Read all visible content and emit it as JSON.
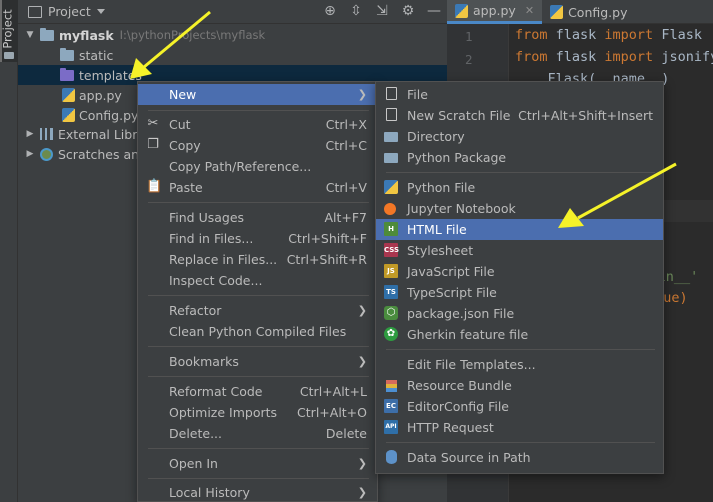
{
  "side_strip": {
    "tab_label": "Project"
  },
  "project_panel": {
    "title": "Project",
    "tree": {
      "root": {
        "name": "myflask",
        "path": "I:\\pythonProjects\\myflask"
      },
      "items": [
        {
          "name": "static"
        },
        {
          "name": "templates"
        },
        {
          "name": "app.py"
        },
        {
          "name": "Config.py"
        },
        {
          "name": "External Libra"
        },
        {
          "name": "Scratches and"
        }
      ]
    }
  },
  "editor": {
    "tabs": [
      {
        "label": "app.py"
      },
      {
        "label": "Config.py"
      }
    ],
    "line_numbers": [
      "1",
      "2"
    ],
    "code": {
      "line1": {
        "kw1": "from",
        "mod": " flask ",
        "kw2": "import",
        "name": " Flask"
      },
      "line2": {
        "kw1": "from",
        "mod": " flask ",
        "kw2": "import",
        "name": " jsonify"
      },
      "line3": "    Flask(__name__)",
      "line4_str": "'__main__'",
      "line5": "True)"
    }
  },
  "context_menu": {
    "items": [
      {
        "label": "New",
        "submenu": true,
        "highlighted": true
      },
      {
        "label": "Cut",
        "shortcut": "Ctrl+X",
        "icon": "scissors-icon"
      },
      {
        "label": "Copy",
        "shortcut": "Ctrl+C",
        "icon": "copy-icon"
      },
      {
        "label": "Copy Path/Reference..."
      },
      {
        "label": "Paste",
        "shortcut": "Ctrl+V",
        "icon": "paste-icon"
      },
      {
        "label": "Find Usages",
        "shortcut": "Alt+F7"
      },
      {
        "label": "Find in Files...",
        "shortcut": "Ctrl+Shift+F"
      },
      {
        "label": "Replace in Files...",
        "shortcut": "Ctrl+Shift+R"
      },
      {
        "label": "Inspect Code..."
      },
      {
        "label": "Refactor",
        "submenu": true
      },
      {
        "label": "Clean Python Compiled Files"
      },
      {
        "label": "Bookmarks",
        "submenu": true
      },
      {
        "label": "Reformat Code",
        "shortcut": "Ctrl+Alt+L"
      },
      {
        "label": "Optimize Imports",
        "shortcut": "Ctrl+Alt+O"
      },
      {
        "label": "Delete...",
        "shortcut": "Delete"
      },
      {
        "label": "Open In",
        "submenu": true
      },
      {
        "label": "Local History",
        "submenu": true
      }
    ]
  },
  "new_submenu": {
    "items": [
      {
        "label": "File",
        "shortcut": ""
      },
      {
        "label": "New Scratch File",
        "shortcut": "Ctrl+Alt+Shift+Insert"
      },
      {
        "label": "Directory"
      },
      {
        "label": "Python Package"
      },
      {
        "label": "Python File"
      },
      {
        "label": "Jupyter Notebook"
      },
      {
        "label": "HTML File",
        "highlighted": true,
        "icon_text": "H"
      },
      {
        "label": "Stylesheet",
        "icon_text": "CSS"
      },
      {
        "label": "JavaScript File",
        "icon_text": "JS"
      },
      {
        "label": "TypeScript File",
        "icon_text": "TS"
      },
      {
        "label": "package.json File",
        "icon_text": "⬡"
      },
      {
        "label": "Gherkin feature file",
        "icon_text": "✿"
      },
      {
        "label": "Edit File Templates..."
      },
      {
        "label": "Resource Bundle"
      },
      {
        "label": "EditorConfig File",
        "icon_text": "EC"
      },
      {
        "label": "HTTP Request",
        "icon_text": "API"
      },
      {
        "label": "Data Source in Path"
      }
    ]
  },
  "colors": {
    "panel_bg": "#3c3f41",
    "editor_bg": "#2b2b2b",
    "menu_highlight": "#4b6eaf",
    "selection": "#0d293e",
    "annotation_arrow": "#f5f229"
  }
}
